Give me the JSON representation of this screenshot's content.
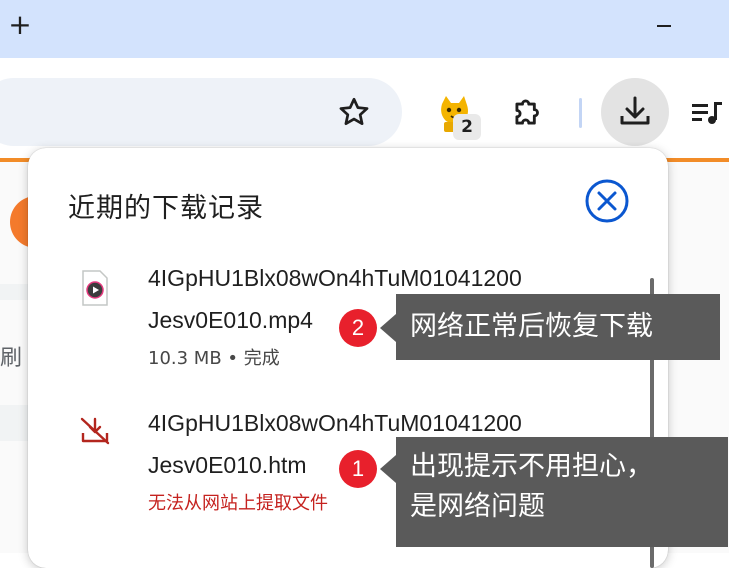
{
  "titlebar": {
    "new_tab_glyph": "+",
    "minimize_glyph": "–"
  },
  "toolbar": {
    "extension_badge": "2",
    "icons": [
      "star-icon",
      "cat-extension-icon",
      "puzzle-icon",
      "download-icon",
      "playlist-icon"
    ]
  },
  "page": {
    "partial_text": "刷"
  },
  "downloads": {
    "title": "近期的下载记录",
    "items": [
      {
        "name_line1": "4IGpHU1Blx08wOn4hTuM01041200",
        "name_line2": "Jesv0E010.mp4",
        "status": "10.3 MB • 完成",
        "icon": "video-file-icon"
      },
      {
        "name_line1": "4IGpHU1Blx08wOn4hTuM01041200",
        "name_line2": "Jesv0E010.htm",
        "status": "无法从网站上提取文件",
        "icon": "download-failed-icon"
      }
    ]
  },
  "annotations": {
    "marker_2": "2",
    "callout_2": "网络正常后恢复下载",
    "marker_1": "1",
    "callout_1_line1": "出现提示不用担心，",
    "callout_1_line2": "是网络问题"
  },
  "colors": {
    "titlebar": "#d3e3fd",
    "accent_orange": "#f28c28",
    "close_blue": "#0b57d0",
    "error_red": "#c5221f",
    "marker_red": "#e8202c",
    "callout_bg": "#5a5a5a"
  }
}
